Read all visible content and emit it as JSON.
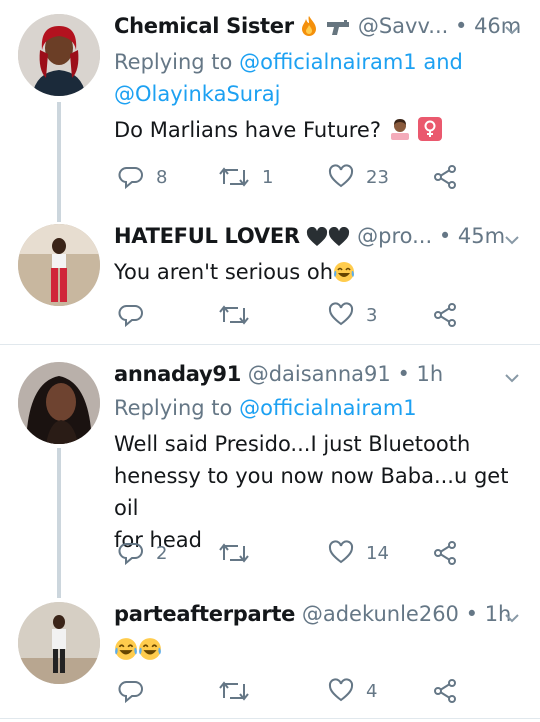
{
  "colors": {
    "link": "#1da1f2",
    "secondary": "#657786",
    "text": "#14171a",
    "divider": "#e1e8ed",
    "thread": "#ccd6dd"
  },
  "tweets": [
    {
      "name": "Chemical Sister",
      "name_suffix_icons": [
        "fire-icon",
        "pistol-icon"
      ],
      "handle": "@Savv...",
      "time": "46m",
      "replying_prefix": "Replying to",
      "replying_mention1": "@officialnairam1",
      "replying_and": "and",
      "replying_mention2": "@OlayinkaSuraj",
      "text": "Do Marlians have Future?",
      "text_trailing_icons": [
        "woman-tipping-hand-icon",
        "female-sign-icon"
      ],
      "replies": "8",
      "retweets": "1",
      "likes": "23"
    },
    {
      "name": "HATEFUL LOVER",
      "name_suffix_icons": [
        "black-heart-icon",
        "black-heart-icon"
      ],
      "handle": "@pro...",
      "time": "45m",
      "text": "You aren't serious oh",
      "text_trailing_icons": [
        "tears-of-joy-icon"
      ],
      "replies": "",
      "retweets": "",
      "likes": "3"
    },
    {
      "name": "annaday91",
      "handle": "@daisanna91",
      "time": "1h",
      "replying_prefix": "Replying to",
      "replying_mention1": "@officialnairam1",
      "text_lines": [
        "Well said Presido...I just Bluetooth",
        "henessy to you now now Baba...u get oil",
        "for head"
      ],
      "replies": "2",
      "retweets": "",
      "likes": "14"
    },
    {
      "name": "parteafterparte",
      "handle": "@adekunle260",
      "time": "1h",
      "text_icons": [
        "tears-of-joy-icon",
        "tears-of-joy-icon"
      ],
      "replies": "",
      "retweets": "",
      "likes": "4"
    }
  ],
  "separator_dot": "•"
}
